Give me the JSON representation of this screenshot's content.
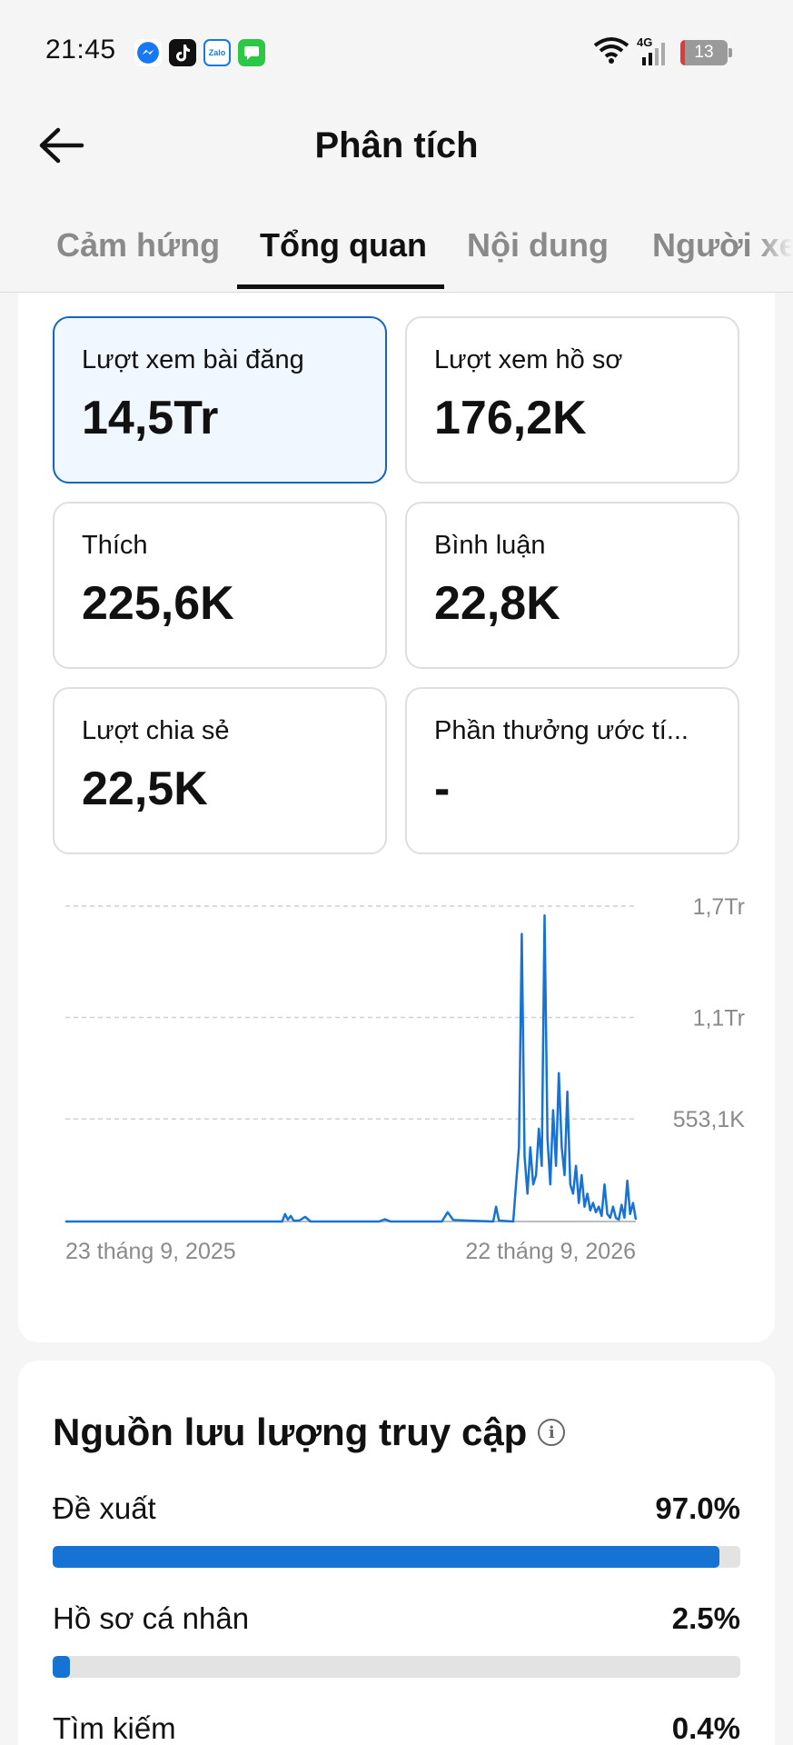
{
  "status_bar": {
    "time": "21:45",
    "network": "4G",
    "battery": "13",
    "app_icons": [
      "messenger-icon",
      "tiktok-icon",
      "zalo-icon",
      "messages-icon"
    ],
    "zalo_text": "Zalo"
  },
  "header": {
    "title": "Phân tích"
  },
  "tabs": [
    {
      "label": "Cảm hứng",
      "active": false
    },
    {
      "label": "Tổng quan",
      "active": true
    },
    {
      "label": "Nội dung",
      "active": false
    },
    {
      "label": "Người xem",
      "active": false
    }
  ],
  "metrics": [
    {
      "label": "Lượt xem bài đăng",
      "value": "14,5Tr",
      "selected": true
    },
    {
      "label": "Lượt xem hồ sơ",
      "value": "176,2K",
      "selected": false
    },
    {
      "label": "Thích",
      "value": "225,6K",
      "selected": false
    },
    {
      "label": "Bình luận",
      "value": "22,8K",
      "selected": false
    },
    {
      "label": "Lượt chia sẻ",
      "value": "22,5K",
      "selected": false
    },
    {
      "label": "Phần thưởng ước tí...",
      "value": "-",
      "selected": false
    }
  ],
  "chart_data": {
    "type": "line",
    "title": "",
    "xlabel": "",
    "ylabel": "",
    "y_tick_labels": [
      "553,1K",
      "1,1Tr",
      "1,7Tr"
    ],
    "y_ticks": [
      553100,
      1100000,
      1700000
    ],
    "ylim": [
      0,
      1700000
    ],
    "x_tick_labels": [
      "23 tháng 9, 2025",
      "22 tháng 9, 2026"
    ],
    "grid": true,
    "color": "#1673d3",
    "series": [
      {
        "values": [
          0,
          0,
          0,
          0,
          0,
          0,
          0,
          0,
          0,
          0,
          0,
          0,
          0,
          0,
          0,
          0,
          0,
          0,
          0,
          0,
          0,
          0,
          0,
          0,
          0,
          0,
          0,
          0,
          0,
          0,
          0,
          0,
          0,
          0,
          0,
          0,
          0,
          0,
          0,
          0,
          0,
          0,
          0,
          0,
          0,
          0,
          0,
          0,
          0,
          0,
          0,
          0,
          0,
          0,
          0,
          0,
          0,
          0,
          0,
          0,
          0,
          0,
          0,
          0,
          0,
          0,
          0,
          0,
          0,
          0,
          0,
          0,
          0,
          0,
          0,
          0,
          0,
          0,
          0,
          0,
          0,
          0,
          0,
          0,
          0,
          0,
          0,
          0,
          0,
          0,
          0,
          0,
          0,
          0,
          0,
          0,
          0,
          0,
          0,
          0,
          0,
          0,
          0,
          0,
          0,
          0,
          0,
          0,
          0,
          0,
          0,
          0,
          0,
          0,
          0,
          0,
          0,
          0,
          0,
          0,
          0,
          0,
          0,
          0,
          0,
          0,
          0,
          0,
          0,
          0,
          0,
          0,
          0,
          0,
          0,
          0,
          0,
          0,
          0,
          0,
          0,
          0,
          0,
          0,
          0,
          0,
          0,
          0,
          0,
          0,
          0,
          0,
          0,
          0,
          0,
          0,
          0,
          0,
          0,
          0,
          0,
          0,
          0,
          0,
          0,
          0,
          0,
          0,
          0,
          0,
          0,
          0,
          0,
          0,
          0,
          0,
          0,
          0,
          0,
          0,
          0,
          0,
          0,
          0,
          0,
          0,
          0,
          0,
          0,
          0,
          0,
          0,
          0,
          0,
          0,
          0,
          0,
          0,
          0,
          0,
          0,
          0,
          0,
          0,
          0,
          0,
          0,
          0,
          0,
          0,
          0,
          0,
          0,
          0,
          0,
          0,
          0,
          0,
          0,
          0,
          0,
          0,
          0,
          0,
          0,
          0,
          0,
          0,
          0,
          0,
          0,
          0,
          0,
          0,
          0,
          0,
          0,
          0,
          0,
          0,
          0,
          0,
          0,
          0,
          0,
          0,
          0,
          0,
          0,
          0,
          0,
          0,
          0,
          0,
          0,
          0,
          0,
          0,
          0,
          0,
          0,
          0,
          0,
          0,
          0,
          0,
          0,
          0,
          0,
          0,
          0,
          0,
          0,
          0,
          0,
          0,
          0,
          0,
          0,
          0,
          0,
          0,
          0,
          0,
          0,
          0,
          0,
          0,
          0,
          0,
          0,
          0,
          0,
          0,
          0,
          0,
          0,
          0,
          0,
          0,
          0,
          0,
          0,
          0,
          0,
          0,
          0,
          0,
          0,
          0,
          0,
          0,
          0,
          0,
          0,
          0,
          0,
          0,
          0,
          0,
          0,
          0,
          0,
          0,
          0,
          0,
          0,
          0,
          0,
          0,
          0,
          0,
          0,
          0,
          0,
          0,
          0,
          0,
          0,
          0,
          0,
          0,
          0,
          0,
          0,
          0,
          0,
          0,
          0,
          0,
          0,
          0,
          0,
          0,
          0,
          0,
          0,
          0,
          0,
          0,
          0,
          0,
          0,
          0,
          0,
          0,
          0,
          0,
          0,
          0
        ]
      }
    ],
    "points": [
      [
        0,
        0
      ],
      [
        0.38,
        0
      ],
      [
        0.385,
        40000
      ],
      [
        0.39,
        10000
      ],
      [
        0.395,
        30000
      ],
      [
        0.4,
        5000
      ],
      [
        0.41,
        5000
      ],
      [
        0.42,
        25000
      ],
      [
        0.43,
        0
      ],
      [
        0.55,
        0
      ],
      [
        0.56,
        12000
      ],
      [
        0.57,
        0
      ],
      [
        0.66,
        0
      ],
      [
        0.67,
        50000
      ],
      [
        0.68,
        8000
      ],
      [
        0.75,
        0
      ],
      [
        0.755,
        80000
      ],
      [
        0.76,
        5000
      ],
      [
        0.785,
        0
      ],
      [
        0.79,
        200000
      ],
      [
        0.795,
        400000
      ],
      [
        0.8,
        1550000
      ],
      [
        0.805,
        350000
      ],
      [
        0.81,
        150000
      ],
      [
        0.815,
        400000
      ],
      [
        0.82,
        200000
      ],
      [
        0.825,
        250000
      ],
      [
        0.83,
        500000
      ],
      [
        0.835,
        300000
      ],
      [
        0.84,
        1650000
      ],
      [
        0.845,
        450000
      ],
      [
        0.85,
        200000
      ],
      [
        0.855,
        600000
      ],
      [
        0.86,
        300000
      ],
      [
        0.865,
        800000
      ],
      [
        0.87,
        400000
      ],
      [
        0.875,
        250000
      ],
      [
        0.88,
        700000
      ],
      [
        0.885,
        200000
      ],
      [
        0.89,
        150000
      ],
      [
        0.895,
        300000
      ],
      [
        0.9,
        100000
      ],
      [
        0.905,
        250000
      ],
      [
        0.91,
        80000
      ],
      [
        0.915,
        150000
      ],
      [
        0.92,
        60000
      ],
      [
        0.925,
        100000
      ],
      [
        0.93,
        50000
      ],
      [
        0.935,
        80000
      ],
      [
        0.94,
        30000
      ],
      [
        0.945,
        200000
      ],
      [
        0.95,
        40000
      ],
      [
        0.955,
        20000
      ],
      [
        0.96,
        80000
      ],
      [
        0.965,
        20000
      ],
      [
        0.97,
        10000
      ],
      [
        0.975,
        90000
      ],
      [
        0.98,
        20000
      ],
      [
        0.985,
        220000
      ],
      [
        0.99,
        40000
      ],
      [
        0.995,
        100000
      ],
      [
        1.0,
        10000
      ]
    ]
  },
  "traffic": {
    "title": "Nguồn lưu lượng truy cập",
    "sources": [
      {
        "label": "Đề xuất",
        "value": "97.0%",
        "percent": 97.0
      },
      {
        "label": "Hồ sơ cá nhân",
        "value": "2.5%",
        "percent": 2.5
      },
      {
        "label": "Tìm kiếm",
        "value": "0.4%",
        "percent": 0.4
      }
    ]
  }
}
